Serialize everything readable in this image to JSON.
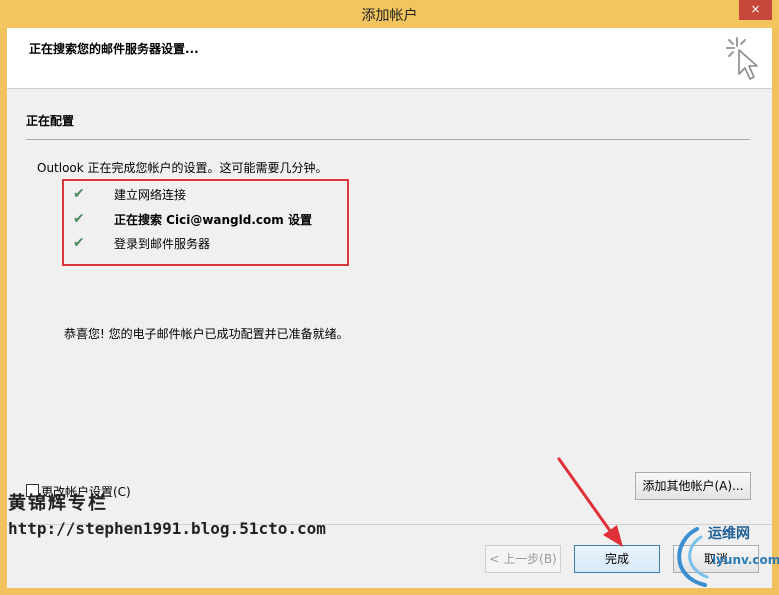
{
  "window": {
    "title": "添加帐户",
    "close_glyph": "×"
  },
  "header": {
    "text": "正在搜索您的邮件服务器设置...",
    "icon": "cursor-sparkle-icon"
  },
  "section": {
    "title": "正在配置",
    "intro": "Outlook 正在完成您帐户的设置。这可能需要几分钟。"
  },
  "steps": [
    {
      "label": "建立网络连接",
      "status": "done"
    },
    {
      "label": "正在搜索 Cici@wangld.com 设置",
      "status": "done"
    },
    {
      "label": "登录到邮件服务器",
      "status": "done"
    }
  ],
  "success_message": "恭喜您! 您的电子邮件帐户已成功配置并已准备就绪。",
  "change_settings": {
    "label": "更改帐户设置(C)",
    "checked": false
  },
  "buttons": {
    "add_other": "添加其他帐户(A)...",
    "back": "< 上一步(B)",
    "finish": "完成",
    "cancel": "取消"
  },
  "watermark": {
    "title": "黄锦辉专栏",
    "url": "http://stephen1991.blog.51cto.com"
  },
  "logo": {
    "brand": "运维网",
    "url": "iyunv.com"
  },
  "colors": {
    "title_bar": "#f2c55e",
    "close_button": "#c7473b",
    "highlight_border": "#d9363e",
    "check": "#4a8a5c",
    "arrow": "#e0303a"
  }
}
